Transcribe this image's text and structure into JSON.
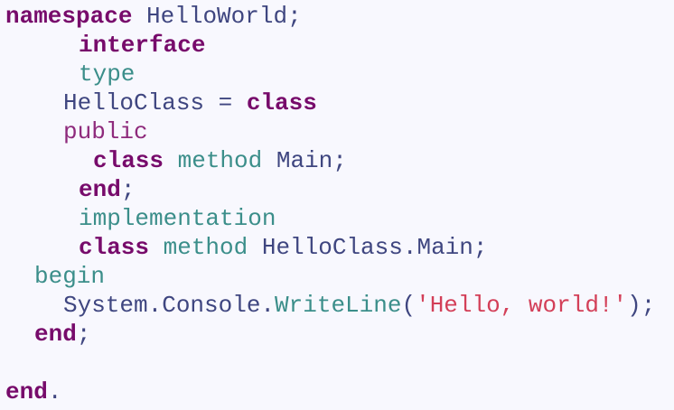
{
  "code": {
    "l1": {
      "kw": "namespace",
      "rest": " HelloWorld;"
    },
    "l2": {
      "kw": "interface"
    },
    "l3": {
      "kw": "type"
    },
    "l4": {
      "name": "HelloClass",
      "op": " = ",
      "kw": "class"
    },
    "l5": {
      "kw": "public"
    },
    "l6": {
      "kw": "class",
      "kw2": " method",
      "rest": " Main;"
    },
    "l7": {
      "kw": "end",
      "rest": ";"
    },
    "l8": {
      "kw": "implementation"
    },
    "l9": {
      "kw": "class",
      "kw2": " method",
      "rest": " HelloClass.Main;"
    },
    "l10": {
      "kw": "begin"
    },
    "l11": {
      "obj": "System.Console.",
      "fn": "WriteLine",
      "open": "(",
      "str": "'Hello, world!'",
      "close": ");"
    },
    "l12": {
      "kw": "end",
      "rest": ";"
    },
    "l13": {
      "kw": "end",
      "rest": "."
    }
  }
}
